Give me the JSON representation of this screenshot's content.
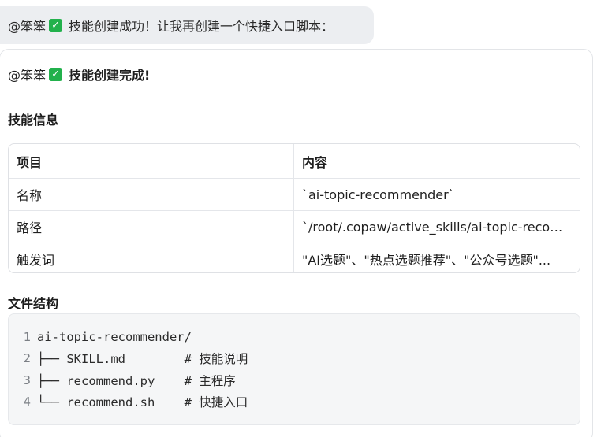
{
  "bubble": {
    "mention": "@笨笨",
    "text": "技能创建成功！让我再创建一个快捷入口脚本："
  },
  "card": {
    "mention": "@笨笨",
    "headline": "技能创建完成!",
    "skill_info_title": "技能信息",
    "table": {
      "headers": [
        "项目",
        "内容"
      ],
      "rows": [
        [
          "名称",
          "`ai-topic-recommender`"
        ],
        [
          "路径",
          "`/root/.copaw/active_skills/ai-topic-recom..."
        ],
        [
          "触发词",
          "\"AI选题\"、\"热点选题推荐\"、\"公众号选题\"..."
        ]
      ]
    },
    "file_structure_title": "文件结构",
    "code": [
      {
        "n": "1",
        "text": "ai-topic-recommender/"
      },
      {
        "n": "2",
        "text": "├── SKILL.md        # 技能说明"
      },
      {
        "n": "3",
        "text": "├── recommend.py    # 主程序"
      },
      {
        "n": "4",
        "text": "└── recommend.sh    # 快捷入口"
      }
    ]
  },
  "colors": {
    "check_green": "#22b14c",
    "bubble_bg": "#eceef1",
    "code_bg": "#f5f6f7"
  },
  "icons": {
    "check": "check-icon"
  }
}
